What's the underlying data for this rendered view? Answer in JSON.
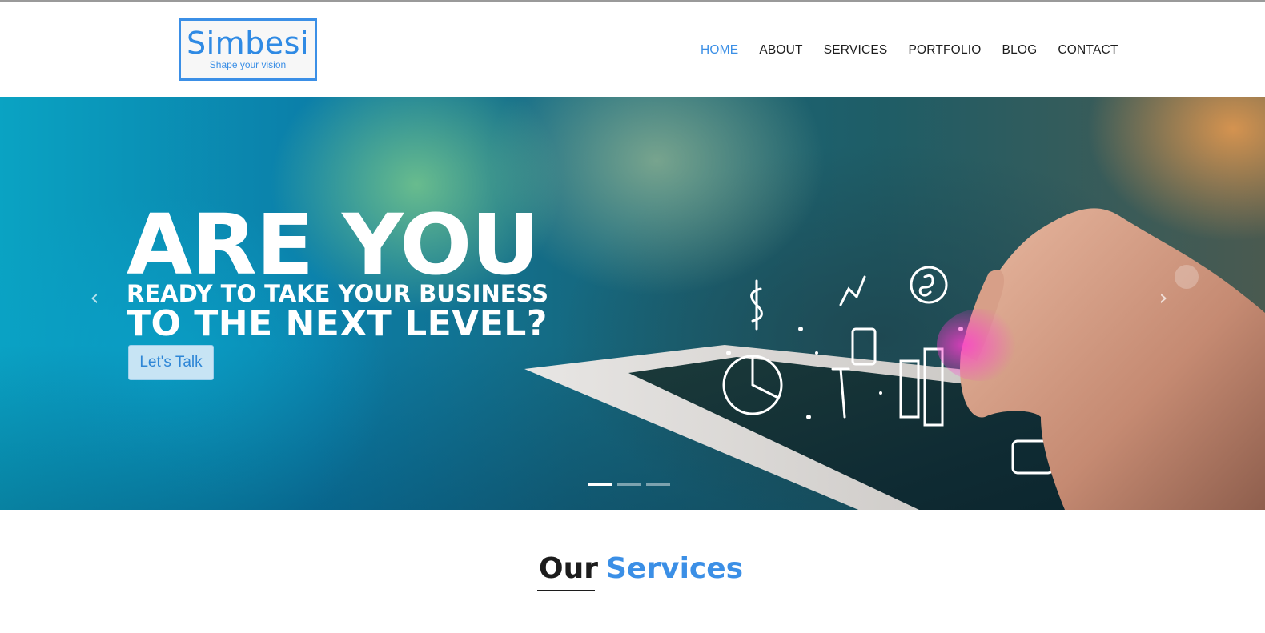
{
  "brand": {
    "name": "Simbesi",
    "tagline": "Shape your vision",
    "accent_color": "#3b8fe6"
  },
  "nav": {
    "items": [
      {
        "label": "HOME",
        "active": true
      },
      {
        "label": "ABOUT",
        "active": false
      },
      {
        "label": "SERVICES",
        "active": false
      },
      {
        "label": "PORTFOLIO",
        "active": false
      },
      {
        "label": "BLOG",
        "active": false
      },
      {
        "label": "CONTACT",
        "active": false
      }
    ]
  },
  "hero": {
    "line1": "ARE YOU",
    "line2": "READY TO TAKE YOUR BUSINESS",
    "line3": "TO THE NEXT LEVEL?",
    "cta_label": "Let's Talk",
    "prev_icon": "chevron-left-icon",
    "next_icon": "chevron-right-icon",
    "slide_count": 3,
    "active_slide": 1
  },
  "services": {
    "title_part1": "Our",
    "title_part2": "Services"
  }
}
